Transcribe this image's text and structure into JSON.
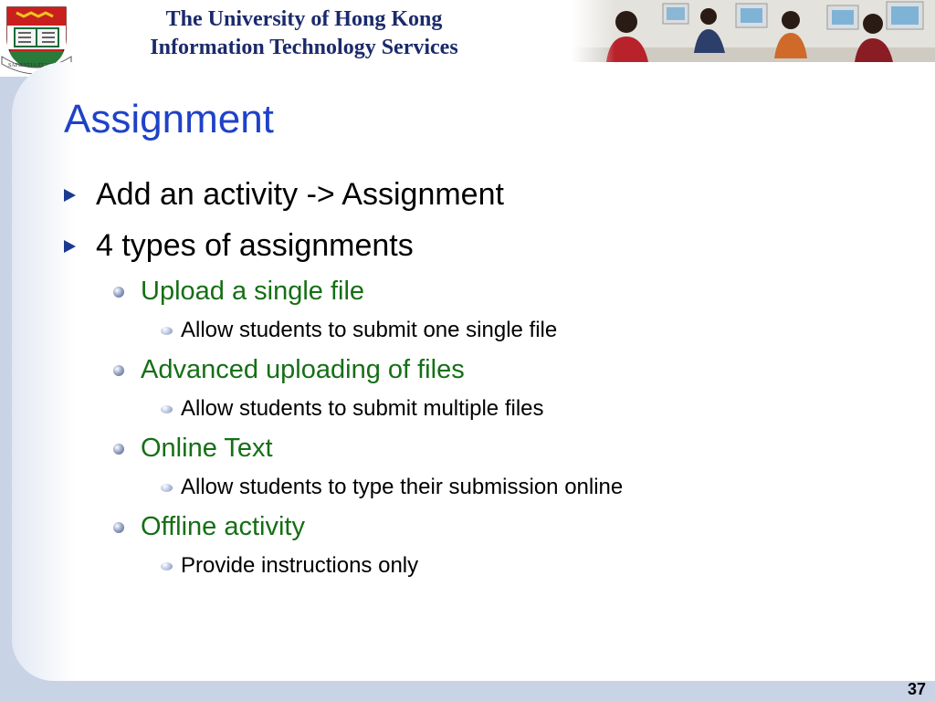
{
  "header": {
    "university": "The University of Hong Kong",
    "department": "Information Technology Services",
    "crest_motto": "SAPIENTIA ET VIRTUS"
  },
  "slide": {
    "title": "Assignment",
    "bullets": [
      {
        "text": "Add an activity -> Assignment"
      },
      {
        "text": "4 types of assignments",
        "children": [
          {
            "text": "Upload a single file",
            "children": [
              {
                "text": "Allow students to submit one single file"
              }
            ]
          },
          {
            "text": "Advanced uploading of files",
            "children": [
              {
                "text": "Allow students to submit multiple files"
              }
            ]
          },
          {
            "text": "Online Text",
            "children": [
              {
                "text": "Allow students to type their submission online"
              }
            ]
          },
          {
            "text": "Offline activity",
            "children": [
              {
                "text": "Provide instructions only"
              }
            ]
          }
        ]
      }
    ]
  },
  "page_number": "37",
  "colors": {
    "title": "#1f42c8",
    "level2": "#156f15",
    "header_text": "#1a2a6b",
    "frame": "#c9d3e6"
  },
  "icons": [
    "university-crest-icon",
    "triangle-bullet-icon",
    "sphere-bullet-icon"
  ]
}
